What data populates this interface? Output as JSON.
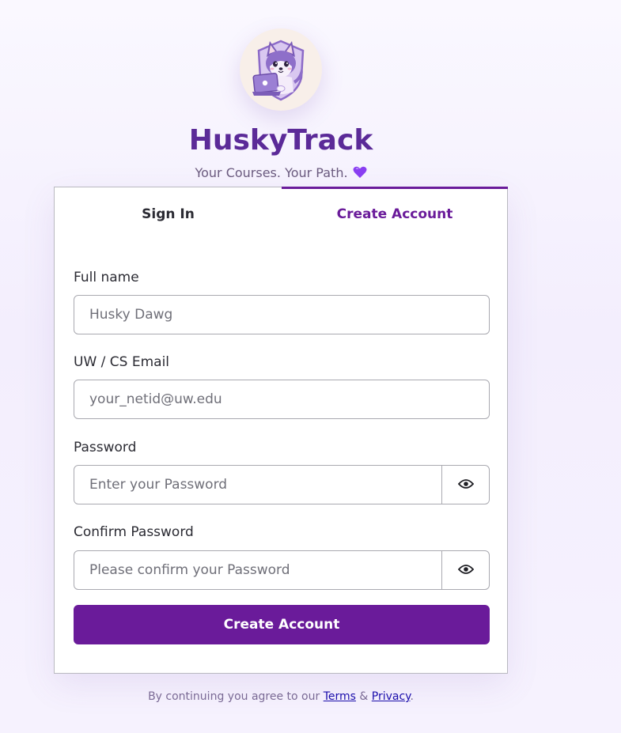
{
  "brand": {
    "title": "HuskyTrack",
    "tagline": "Your Courses. Your Path.",
    "logo_icon": "husky-laptop-logo",
    "heart_icon": "purple-heart-icon",
    "accent_color": "#6a1b9a",
    "title_color": "#5b2a98"
  },
  "tabs": {
    "sign_in": "Sign In",
    "create_account": "Create Account",
    "active": "create_account"
  },
  "form": {
    "full_name": {
      "label": "Full name",
      "placeholder": "Husky Dawg",
      "value": ""
    },
    "email": {
      "label": "UW / CS Email",
      "placeholder": "your_netid@uw.edu",
      "value": ""
    },
    "password": {
      "label": "Password",
      "placeholder": "Enter your Password",
      "value": "",
      "toggle_icon": "eye-icon"
    },
    "confirm_password": {
      "label": "Confirm Password",
      "placeholder": "Please confirm your Password",
      "value": "",
      "toggle_icon": "eye-icon"
    },
    "submit_label": "Create Account"
  },
  "footer": {
    "prefix": "By continuing you agree to our",
    "terms": "Terms",
    "amp": "&",
    "privacy": "Privacy",
    "suffix": "."
  }
}
